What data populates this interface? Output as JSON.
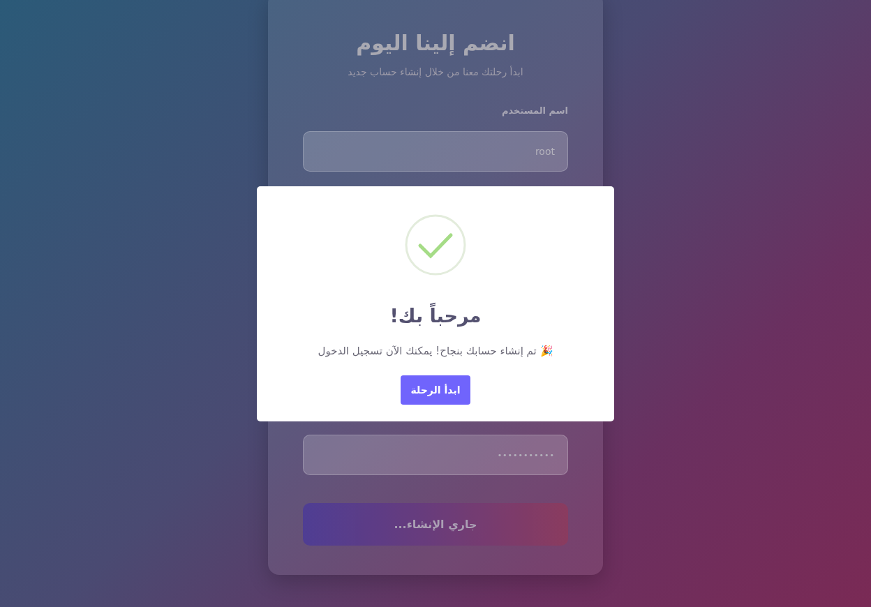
{
  "form": {
    "title": "انضم إلينا اليوم",
    "subtitle": "ابدأ رحلتك معنا من خلال إنشاء حساب جديد",
    "fields": [
      {
        "kind": "text",
        "label": "اسم المستخدم",
        "value": "root"
      },
      {
        "kind": "password",
        "value": "•••••••••••"
      }
    ],
    "submit_button": {
      "label": "جاري الإنشاء...",
      "loading": true
    }
  },
  "modal": {
    "kind": "success",
    "title": "مرحباً بك!",
    "message": "🎉 تم إنشاء حسابك بنجاح! يمكنك الآن تسجيل الدخول",
    "button": "ابدأ الرحلة"
  }
}
